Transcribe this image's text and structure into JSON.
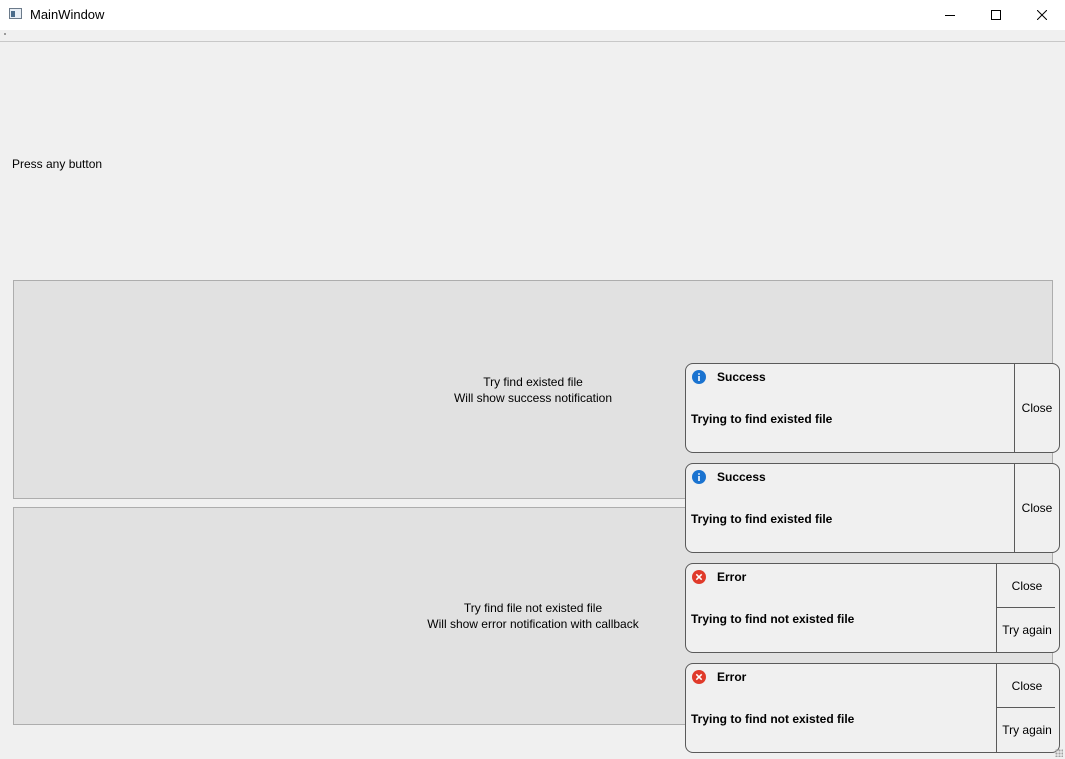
{
  "window": {
    "title": "MainWindow",
    "controls": [
      "minimize-icon",
      "maximize-icon",
      "close-icon"
    ]
  },
  "main": {
    "status_text": "Press any button",
    "success_button": {
      "line1": "Try find existed file",
      "line2": "Will show success notification"
    },
    "error_button": {
      "line1": "Try find file not existed file",
      "line2": "Will show error notification with callback"
    }
  },
  "notifications": [
    {
      "type": "success",
      "icon": "info-icon",
      "title": "Success",
      "message": "Trying to find existed file",
      "close_label": "Close"
    },
    {
      "type": "success",
      "icon": "info-icon",
      "title": "Success",
      "message": "Trying to find existed file",
      "close_label": "Close"
    },
    {
      "type": "error",
      "icon": "error-icon",
      "title": "Error",
      "message": "Trying to find not existed file",
      "close_label": "Close",
      "retry_label": "Try again"
    },
    {
      "type": "error",
      "icon": "error-icon",
      "title": "Error",
      "message": "Trying to find not existed file",
      "close_label": "Close",
      "retry_label": "Try again"
    }
  ],
  "colors": {
    "info_icon": "#1a73d0",
    "error_icon": "#e03a2a",
    "toast_border": "#5a5a5a",
    "button_face": "#e1e1e1"
  }
}
